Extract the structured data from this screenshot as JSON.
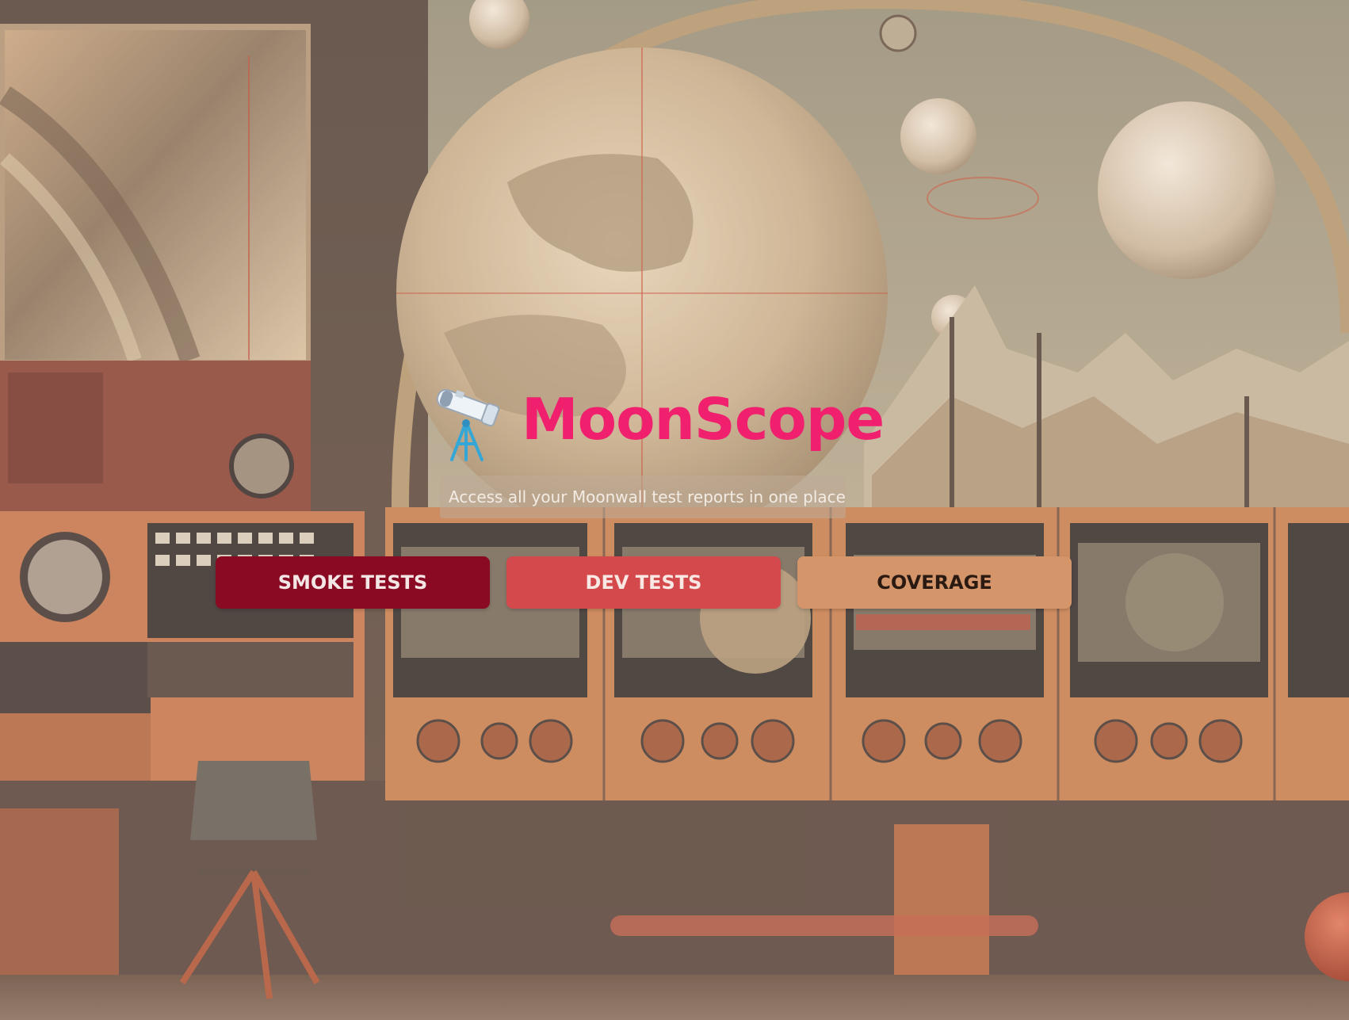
{
  "app": {
    "title": "MoonScope",
    "tagline": "Access all your Moonwall test reports in one place."
  },
  "icons": {
    "logo": "telescope-icon"
  },
  "nav": {
    "buttons": [
      {
        "label": "SMOKE TESTS",
        "color": "#8a0a23"
      },
      {
        "label": "DEV TESTS",
        "color": "#d44a4c"
      },
      {
        "label": "COVERAGE",
        "color": "#d4956a"
      }
    ]
  },
  "colors": {
    "title": "#f0206e",
    "background": "#6e5a4a"
  }
}
